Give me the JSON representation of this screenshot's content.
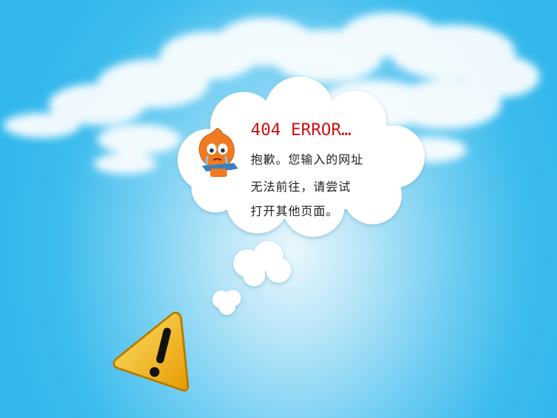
{
  "error": {
    "title": "404 ERROR…",
    "lines": [
      "抱歉。您输入的网址",
      "无法前往，请尝试",
      "打开其他页面。"
    ]
  },
  "icons": {
    "mascot": "crying-mascot-icon",
    "warning": "warning-triangle-icon"
  },
  "colors": {
    "title": "#cc1111",
    "sky": "#33b8ec",
    "warning": "#f2b705"
  }
}
